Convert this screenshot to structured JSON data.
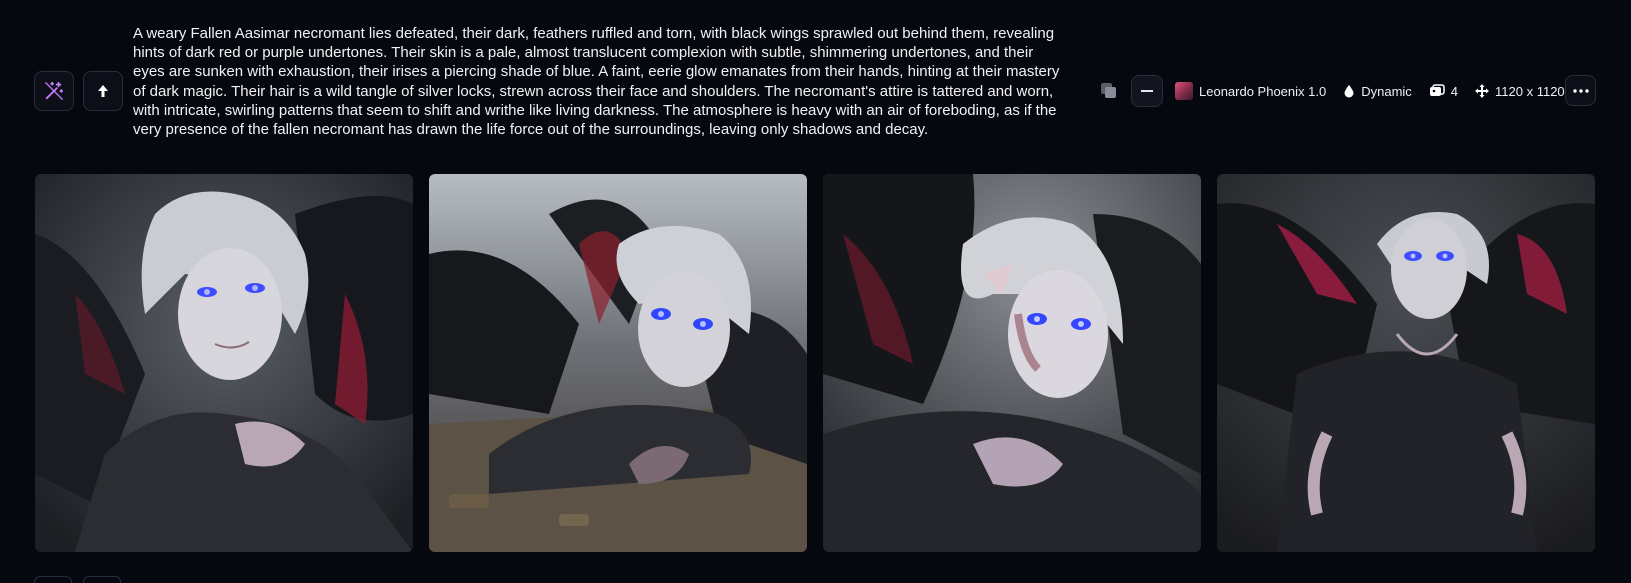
{
  "prompt": {
    "text": "A weary Fallen Aasimar necromant lies defeated, their dark, feathers ruffled and torn, with black wings sprawled out behind them, revealing hints of dark red or purple undertones. Their skin is a pale, almost translucent complexion with subtle, shimmering undertones, and their eyes are sunken with exhaustion, their irises a piercing shade of blue. A faint, eerie glow emanates from their hands, hinting at their mastery of dark magic. Their hair is a wild tangle of silver locks, strewn across their face and shoulders. The necromant's attire is tattered and worn, with intricate, swirling patterns that seem to shift and writhe like living darkness. The atmosphere is heavy with an air of foreboding, as if the very presence of the fallen necromant has drawn the life force out of the surroundings, leaving only shadows and decay."
  },
  "actions": {
    "magic_icon": "magic-wand-icon",
    "upscale_icon": "arrow-up-icon"
  },
  "meta": {
    "model": "Leonardo Phoenix 1.0",
    "style": "Dynamic",
    "count": "4",
    "dimensions": "1120 x 1120px"
  },
  "colors": {
    "background": "#06080f",
    "magic_icon": "#c67bff",
    "border": "#2a2d3a"
  },
  "images": [
    {
      "subject": "fallen-aasimar-reclining"
    },
    {
      "subject": "fallen-aasimar-prone"
    },
    {
      "subject": "fallen-aasimar-elf-ears"
    },
    {
      "subject": "fallen-aasimar-lying-back"
    }
  ]
}
